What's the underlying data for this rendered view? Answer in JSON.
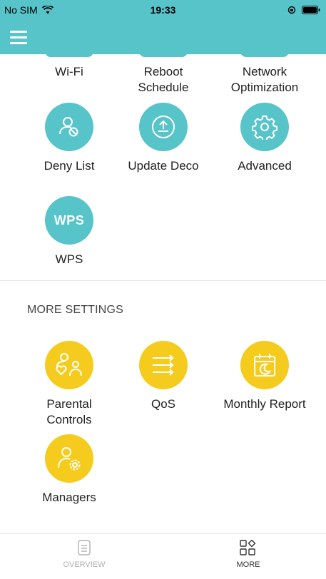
{
  "status": {
    "carrier": "No SIM",
    "time": "19:33"
  },
  "network_section": {
    "items": [
      {
        "label_line1": "Wi-Fi",
        "label_line2": ""
      },
      {
        "label_line1": "Reboot",
        "label_line2": "Schedule"
      },
      {
        "label_line1": "Network",
        "label_line2": "Optimization"
      },
      {
        "label_line1": "Deny List",
        "label_line2": ""
      },
      {
        "label_line1": "Update Deco",
        "label_line2": ""
      },
      {
        "label_line1": "Advanced",
        "label_line2": ""
      },
      {
        "label_line1": "WPS",
        "label_line2": "",
        "icon_text": "WPS"
      }
    ],
    "color": "#57c4c9"
  },
  "more_settings": {
    "title": "MORE SETTINGS",
    "items": [
      {
        "label_line1": "Parental",
        "label_line2": "Controls"
      },
      {
        "label_line1": "QoS",
        "label_line2": ""
      },
      {
        "label_line1": "Monthly Report",
        "label_line2": ""
      },
      {
        "label_line1": "Managers",
        "label_line2": ""
      }
    ],
    "color": "#f5cc1e"
  },
  "tabbar": {
    "overview": "OVERVIEW",
    "more": "MORE"
  }
}
